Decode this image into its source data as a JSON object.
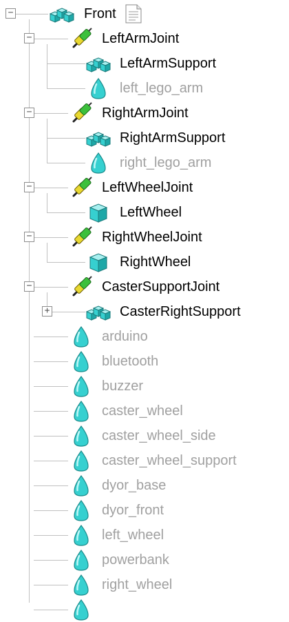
{
  "colors": {
    "tree_line": "#c0c0c0",
    "active_text": "#000000",
    "inactive_text": "#a0a0a0",
    "shape_cyan": "#36d0d0",
    "joint_green": "#3cc03c",
    "joint_yellow": "#e8d830"
  },
  "tree": {
    "root": {
      "label": "Front",
      "icon": "transform-group-icon",
      "state": "expanded",
      "badge_icon": "document-icon"
    },
    "nodes": [
      {
        "label": "LeftArmJoint",
        "icon": "joint-icon",
        "state": "expanded",
        "level": 1
      },
      {
        "label": "LeftArmSupport",
        "icon": "transform-group-icon",
        "state": "leaf",
        "level": 2
      },
      {
        "label": "left_lego_arm",
        "icon": "shape-icon",
        "state": "leaf",
        "level": 2
      },
      {
        "label": "RightArmJoint",
        "icon": "joint-icon",
        "state": "expanded",
        "level": 1
      },
      {
        "label": "RightArmSupport",
        "icon": "transform-group-icon",
        "state": "leaf",
        "level": 2
      },
      {
        "label": "right_lego_arm",
        "icon": "shape-icon",
        "state": "leaf",
        "level": 2
      },
      {
        "label": "LeftWheelJoint",
        "icon": "joint-icon",
        "state": "expanded",
        "level": 1
      },
      {
        "label": "LeftWheel",
        "icon": "transform-icon",
        "state": "leaf",
        "level": 2
      },
      {
        "label": "RightWheelJoint",
        "icon": "joint-icon",
        "state": "expanded",
        "level": 1
      },
      {
        "label": "RightWheel",
        "icon": "transform-icon",
        "state": "leaf",
        "level": 2
      },
      {
        "label": "CasterSupportJoint",
        "icon": "joint-icon",
        "state": "expanded",
        "level": 1
      },
      {
        "label": "CasterRightSupport",
        "icon": "transform-group-icon",
        "state": "collapsed",
        "level": 2
      },
      {
        "label": "arduino",
        "icon": "shape-icon",
        "state": "leaf",
        "level": 1
      },
      {
        "label": "bluetooth",
        "icon": "shape-icon",
        "state": "leaf",
        "level": 1
      },
      {
        "label": "buzzer",
        "icon": "shape-icon",
        "state": "leaf",
        "level": 1
      },
      {
        "label": "caster_wheel",
        "icon": "shape-icon",
        "state": "leaf",
        "level": 1
      },
      {
        "label": "caster_wheel_side",
        "icon": "shape-icon",
        "state": "leaf",
        "level": 1
      },
      {
        "label": "caster_wheel_support",
        "icon": "shape-icon",
        "state": "leaf",
        "level": 1
      },
      {
        "label": "dyor_base",
        "icon": "shape-icon",
        "state": "leaf",
        "level": 1
      },
      {
        "label": "dyor_front",
        "icon": "shape-icon",
        "state": "leaf",
        "level": 1
      },
      {
        "label": "left_wheel",
        "icon": "shape-icon",
        "state": "leaf",
        "level": 1
      },
      {
        "label": "powerbank",
        "icon": "shape-icon",
        "state": "leaf",
        "level": 1
      },
      {
        "label": "right_wheel",
        "icon": "shape-icon",
        "state": "leaf",
        "level": 1
      },
      {
        "label": "",
        "icon": "shape-icon",
        "state": "leaf",
        "level": 1
      }
    ]
  }
}
